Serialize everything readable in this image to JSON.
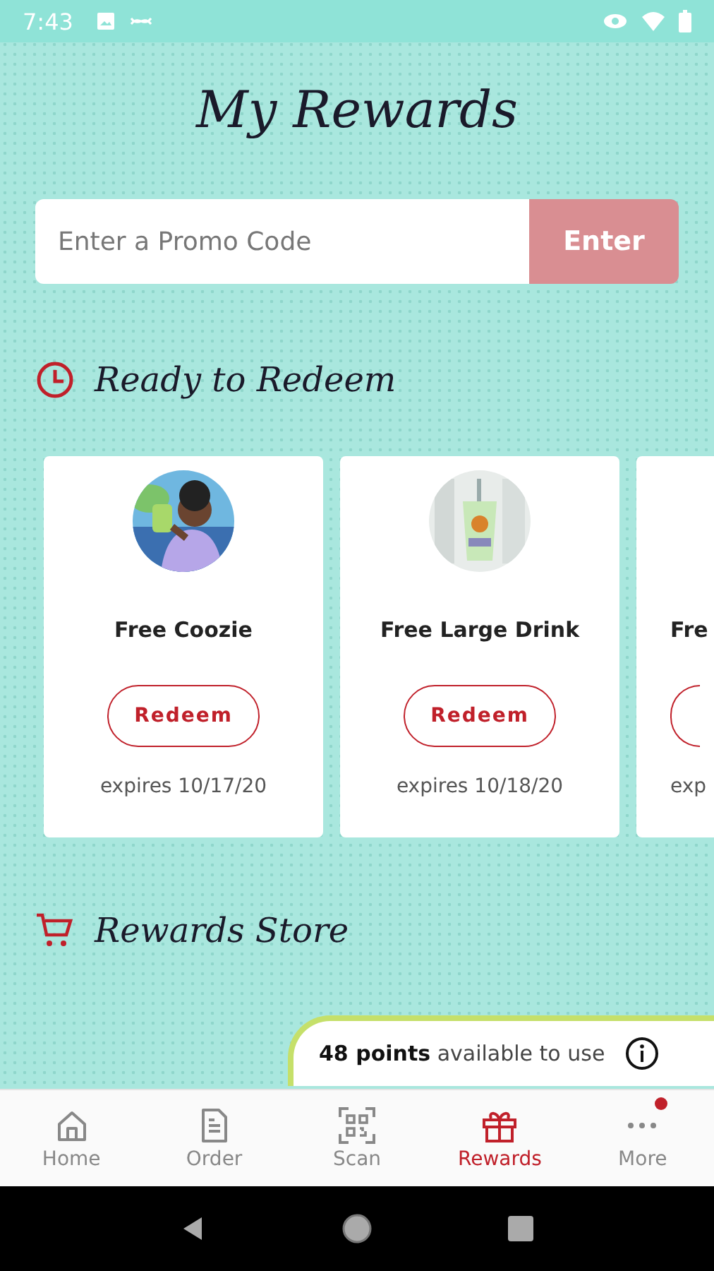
{
  "status_bar": {
    "time": "7:43"
  },
  "title": "My Rewards",
  "promo": {
    "placeholder": "Enter a Promo Code",
    "button": "Enter"
  },
  "ready_section": {
    "heading": "Ready to Redeem"
  },
  "rewards": [
    {
      "kind": "full",
      "title": "Free Coozie",
      "button": "Redeem",
      "expires": "expires 10/17/20"
    },
    {
      "kind": "full",
      "title": "Free Large Drink",
      "button": "Redeem",
      "expires": "expires 10/18/20"
    },
    {
      "kind": "cut",
      "title": "Fre",
      "expires": "exp"
    }
  ],
  "store_section": {
    "heading": "Rewards Store"
  },
  "points": {
    "text": "**48 points** available to use"
  },
  "tabs": [
    {
      "label": "Home",
      "selected": false,
      "badge": false
    },
    {
      "label": "Order",
      "selected": false,
      "badge": false
    },
    {
      "label": "Scan",
      "selected": false,
      "badge": false
    },
    {
      "label": "Rewards",
      "selected": true,
      "badge": false
    },
    {
      "label": "More",
      "selected": false,
      "badge": true
    }
  ]
}
